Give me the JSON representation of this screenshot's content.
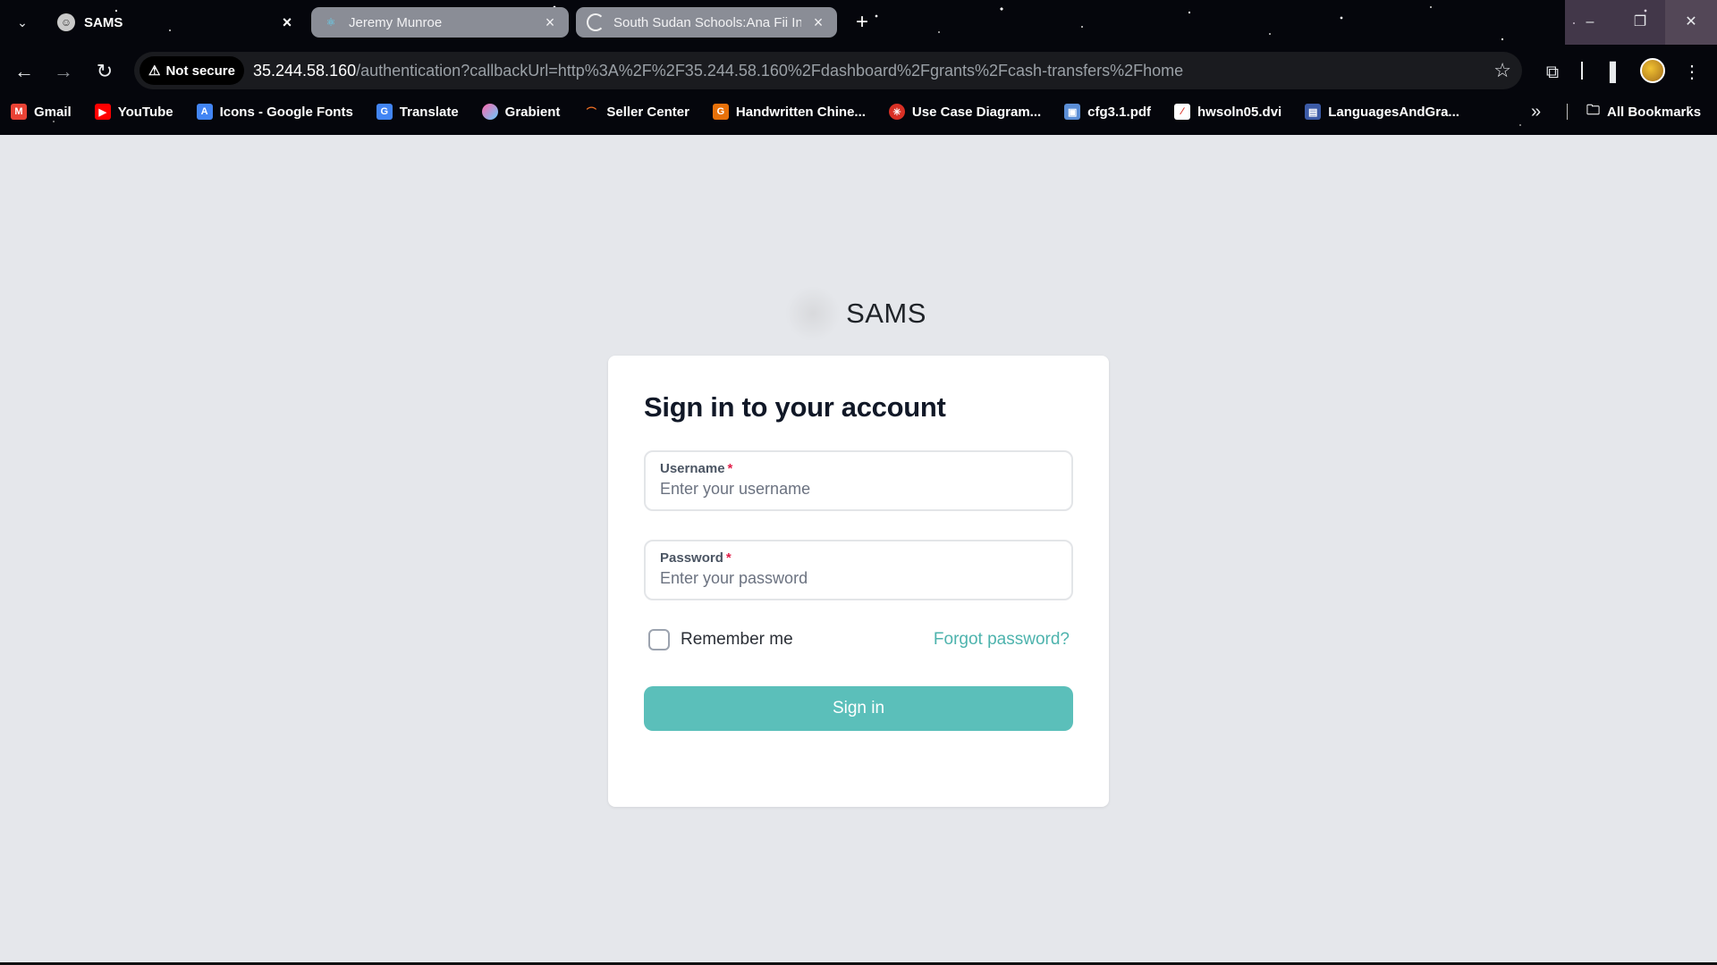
{
  "browser": {
    "tabs": [
      {
        "title": "SAMS",
        "active": true
      },
      {
        "title": "Jeremy Munroe",
        "active": false
      },
      {
        "title": "South Sudan Schools:Ana Fii In",
        "active": false,
        "loading": true
      }
    ],
    "address": {
      "security_label": "Not secure",
      "host": "35.244.58.160",
      "path": "/authentication?callbackUrl=http%3A%2F%2F35.244.58.160%2Fdashboard%2Fgrants%2Fcash-transfers%2Fhome"
    },
    "bookmarks": [
      {
        "label": "Gmail",
        "icon": "gmail-icon",
        "color": "#ea4335"
      },
      {
        "label": "YouTube",
        "icon": "youtube-icon",
        "color": "#ff0000"
      },
      {
        "label": "Icons - Google Fonts",
        "icon": "google-fonts-icon",
        "color": "#4285f4"
      },
      {
        "label": "Translate",
        "icon": "translate-icon",
        "color": "#4285f4"
      },
      {
        "label": "Grabient",
        "icon": "grabient-icon",
        "color": "#c86dd7"
      },
      {
        "label": "Seller Center",
        "icon": "seller-center-icon",
        "color": "#f57224"
      },
      {
        "label": "Handwritten Chine...",
        "icon": "handwritten-icon",
        "color": "#e8710a"
      },
      {
        "label": "Use Case Diagram...",
        "icon": "diagram-icon",
        "color": "#d93025"
      },
      {
        "label": "cfg3.1.pdf",
        "icon": "pdf-icon",
        "color": "#5b8ed6"
      },
      {
        "label": "hwsoln05.dvi",
        "icon": "dvi-icon",
        "color": "#d93025"
      },
      {
        "label": "LanguagesAndGra...",
        "icon": "doc-icon",
        "color": "#3b5aa6"
      }
    ],
    "all_bookmarks_label": "All Bookmarks"
  },
  "page": {
    "brand_name": "SAMS",
    "heading": "Sign in to your account",
    "username": {
      "label": "Username",
      "required_mark": "*",
      "placeholder": "Enter your username",
      "value": ""
    },
    "password": {
      "label": "Password",
      "required_mark": "*",
      "placeholder": "Enter your password",
      "value": ""
    },
    "remember_label": "Remember me",
    "remember_checked": false,
    "forgot_label": "Forgot password?",
    "submit_label": "Sign in",
    "colors": {
      "accent": "#5bbfba",
      "link": "#4db3ad",
      "background": "#e5e7eb"
    }
  }
}
